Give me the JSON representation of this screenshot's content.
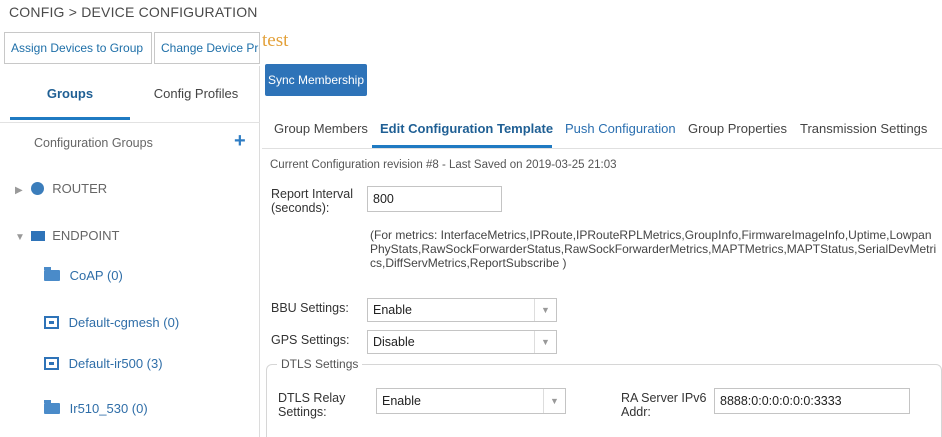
{
  "breadcrumb": "CONFIG > DEVICE CONFIGURATION",
  "top_buttons": {
    "assign": "Assign Devices to Group",
    "change": "Change Device Pro"
  },
  "overlay_text": "test",
  "sync_button": "Sync Membership",
  "left_tabs": {
    "groups": "Groups",
    "config_profiles": "Config Profiles"
  },
  "config_groups_label": "Configuration Groups",
  "tree": {
    "router": "ROUTER",
    "endpoint": "ENDPOINT",
    "children": [
      {
        "label": "CoAP (0)",
        "icon": "folder-icon"
      },
      {
        "label": "Default-cgmesh (0)",
        "icon": "box-icon"
      },
      {
        "label": "Default-ir500 (3)",
        "icon": "box-icon"
      },
      {
        "label": "Ir510_530 (0)",
        "icon": "folder-icon"
      }
    ]
  },
  "right_tabs": {
    "members": "Group Members",
    "edit": "Edit Configuration Template",
    "push": "Push Configuration",
    "props": "Group Properties",
    "trans": "Transmission Settings"
  },
  "revision_text": "Current Configuration revision #8 - Last Saved on 2019-03-25 21:03",
  "form": {
    "report_interval_label": "Report Interval (seconds):",
    "report_interval_value": "800",
    "metrics_note": "(For metrics: InterfaceMetrics,IPRoute,IPRouteRPLMetrics,GroupInfo,FirmwareImageInfo,Uptime,LowpanPhyStats,RawSockForwarderStatus,RawSockForwarderMetrics,MAPTMetrics,MAPTStatus,SerialDevMetrics,DiffServMetrics,ReportSubscribe )",
    "bbu_label": "BBU Settings:",
    "bbu_value": "Enable",
    "gps_label": "GPS Settings:",
    "gps_value": "Disable",
    "dtls_legend": "DTLS Settings",
    "dtls_relay_label": "DTLS Relay Settings:",
    "dtls_relay_value": "Enable",
    "ra_server_label": "RA Server IPv6 Addr:",
    "ra_server_value": "8888:0:0:0:0:0:0:3333"
  },
  "colors": {
    "accent": "#2e73b8",
    "active_tab": "#1f5f94",
    "overlay": "#e3a13a"
  }
}
